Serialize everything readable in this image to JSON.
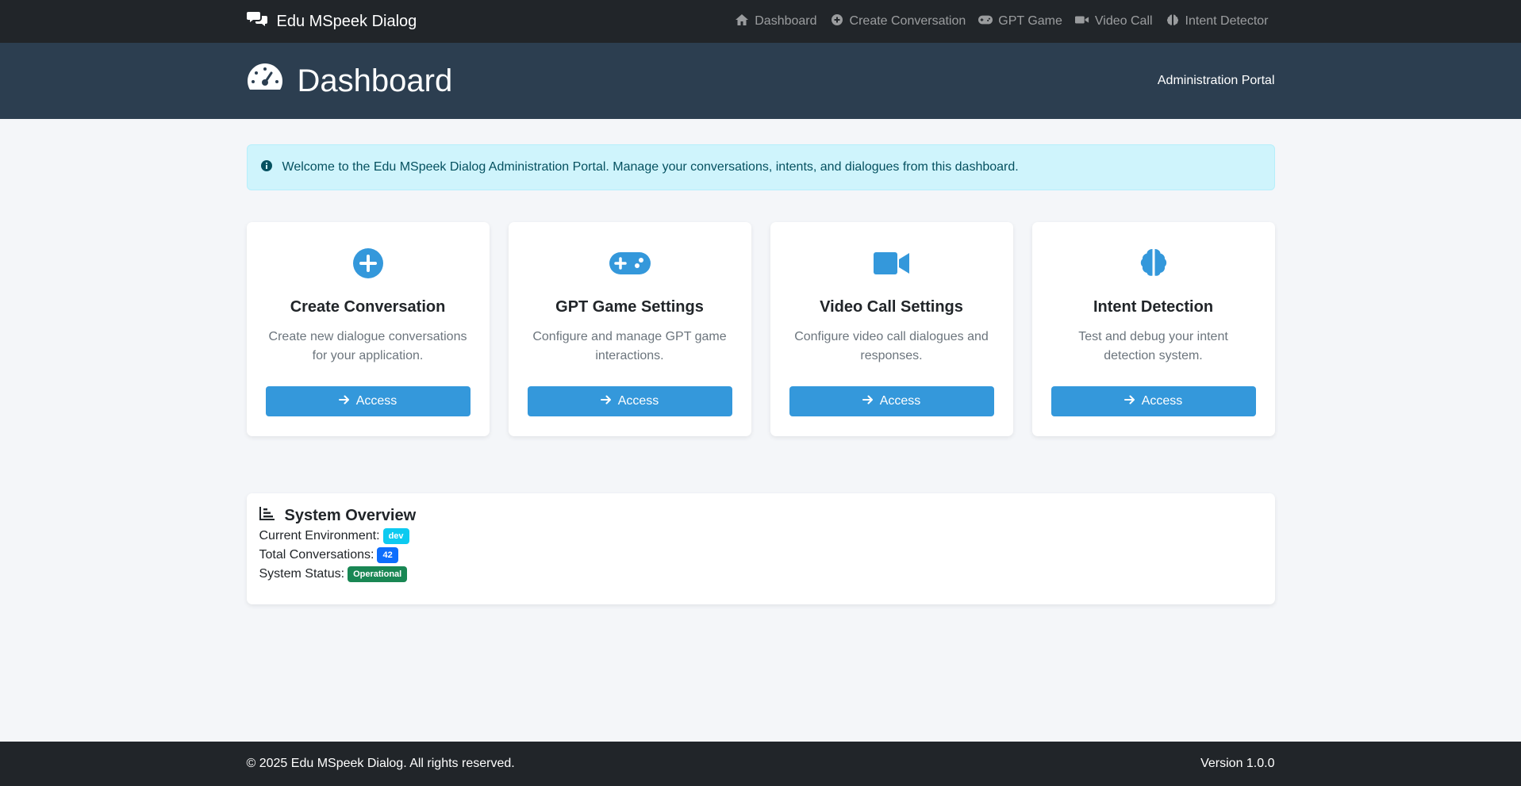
{
  "navbar": {
    "brand": "Edu MSpeek Dialog",
    "brand_icon": "comments-icon",
    "items": [
      {
        "label": "Dashboard",
        "icon": "home-icon"
      },
      {
        "label": "Create Conversation",
        "icon": "plus-circle-icon"
      },
      {
        "label": "GPT Game",
        "icon": "gamepad-icon"
      },
      {
        "label": "Video Call",
        "icon": "video-icon"
      },
      {
        "label": "Intent Detector",
        "icon": "brain-icon"
      }
    ]
  },
  "header": {
    "title": "Dashboard",
    "title_icon": "tachometer-icon",
    "portal": "Administration Portal"
  },
  "alert": {
    "text": "Welcome to the Edu MSpeek Dialog Administration Portal. Manage your conversations, intents, and dialogues from this dashboard.",
    "icon": "info-circle-icon"
  },
  "cards": [
    {
      "title": "Create Conversation",
      "desc": "Create new dialogue conversations for your application.",
      "button": "Access",
      "icon": "plus-circle-icon"
    },
    {
      "title": "GPT Game Settings",
      "desc": "Configure and manage GPT game interactions.",
      "button": "Access",
      "icon": "gamepad-icon"
    },
    {
      "title": "Video Call Settings",
      "desc": "Configure video call dialogues and responses.",
      "button": "Access",
      "icon": "video-icon"
    },
    {
      "title": "Intent Detection",
      "desc": "Test and debug your intent detection system.",
      "button": "Access",
      "icon": "brain-icon"
    }
  ],
  "overview": {
    "title": "System Overview",
    "icon": "chart-bar-icon",
    "environment_label": "Current Environment:",
    "environment_value": "dev",
    "conversations_label": "Total Conversations:",
    "conversations_value": "42",
    "status_label": "System Status:",
    "status_value": "Operational"
  },
  "footer": {
    "copyright": "© 2025 Edu MSpeek Dialog. All rights reserved.",
    "version": "Version 1.0.0"
  },
  "colors": {
    "navbar": "#212529",
    "header": "#2c3e50",
    "accent": "#3498db",
    "badge_env": "#0dcaf0",
    "badge_count": "#0d6efd",
    "badge_status": "#198754"
  }
}
